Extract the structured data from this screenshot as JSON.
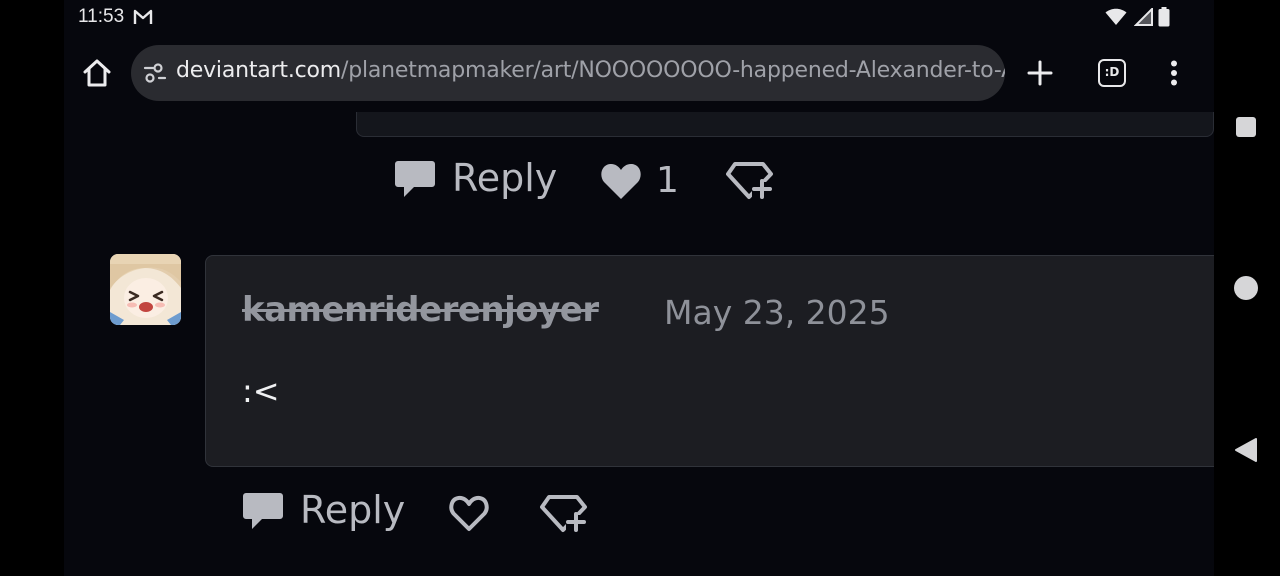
{
  "status_bar": {
    "time": "11:53",
    "icons": [
      "gmail-icon",
      "wifi-icon",
      "signal-icon",
      "battery-icon"
    ]
  },
  "browser": {
    "url_host": "deviantart.com",
    "url_path": "/planetmapmaker/art/NOOOOOOOO-happened-Alexander-to-Ale",
    "tab_switcher_label": ":D",
    "icons": [
      "home-icon",
      "site-info-icon",
      "plus-icon",
      "more-vert-icon"
    ]
  },
  "previous_comment": {
    "reply_label": "Reply",
    "like_count": "1"
  },
  "comment": {
    "author": "kamenriderenjoyer",
    "date": "May 23, 2025",
    "body": ":<",
    "reply_label": "Reply"
  },
  "colors": {
    "background": "#06070d",
    "card": "#1c1d22",
    "muted_text": "#b8bac1",
    "urlbar": "#2a2b30"
  }
}
